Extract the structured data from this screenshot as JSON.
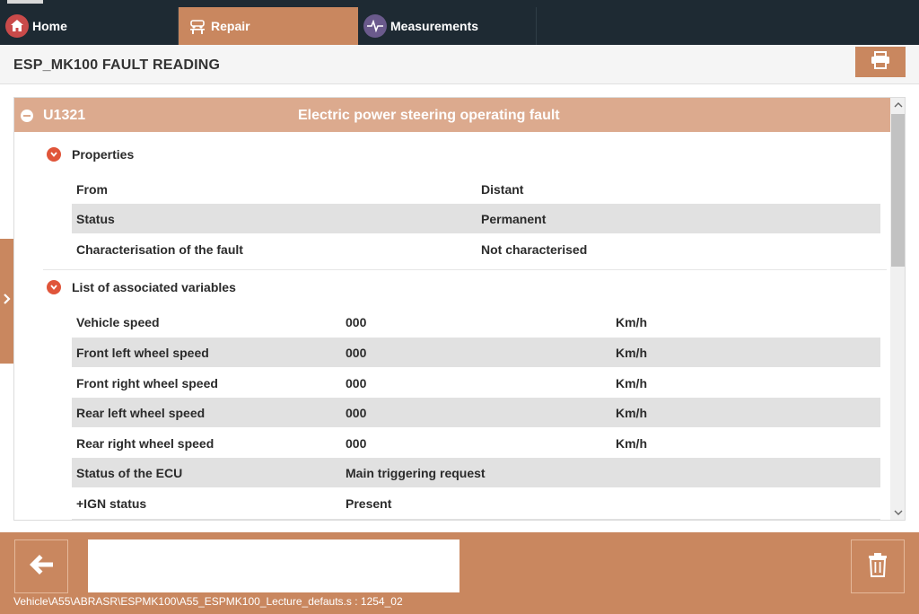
{
  "nav": {
    "home_label": "Home",
    "repair_label": "Repair",
    "measurements_label": "Measurements",
    "home_icon": "home-icon",
    "repair_icon": "car-lift-icon",
    "measurements_icon": "waveform-icon"
  },
  "header": {
    "title": "ESP_MK100 FAULT READING",
    "print_icon": "printer-icon"
  },
  "fault": {
    "code": "U1321",
    "description": "Electric power steering operating fault"
  },
  "properties": {
    "title": "Properties",
    "rows": [
      {
        "label": "From",
        "value": "Distant"
      },
      {
        "label": "Status",
        "value": "Permanent"
      },
      {
        "label": "Characterisation of the fault",
        "value": "Not characterised"
      }
    ]
  },
  "variables": {
    "title": "List of associated variables",
    "rows": [
      {
        "label": "Vehicle speed",
        "value": "000",
        "unit": "Km/h"
      },
      {
        "label": "Front left wheel speed",
        "value": "000",
        "unit": "Km/h"
      },
      {
        "label": "Front right wheel speed",
        "value": "000",
        "unit": "Km/h"
      },
      {
        "label": "Rear left wheel speed",
        "value": "000",
        "unit": "Km/h"
      },
      {
        "label": "Rear right wheel speed",
        "value": "000",
        "unit": "Km/h"
      },
      {
        "label": "Status of the ECU",
        "value": "Main triggering request",
        "unit": ""
      },
      {
        "label": "+IGN status",
        "value": "Present",
        "unit": ""
      }
    ]
  },
  "footer": {
    "message": "",
    "path": "Vehicle\\A55\\ABRASR\\ESPMK100\\A55_ESPMK100_Lecture_defauts.s : 1254_02",
    "back_icon": "arrow-left-icon",
    "delete_icon": "trash-icon"
  },
  "colors": {
    "accent": "#c9875f",
    "fault_header": "#dcaa8e",
    "nav_bg": "#1e2a33",
    "chevron": "#e0553a",
    "row_shade": "#e1e1e1"
  }
}
